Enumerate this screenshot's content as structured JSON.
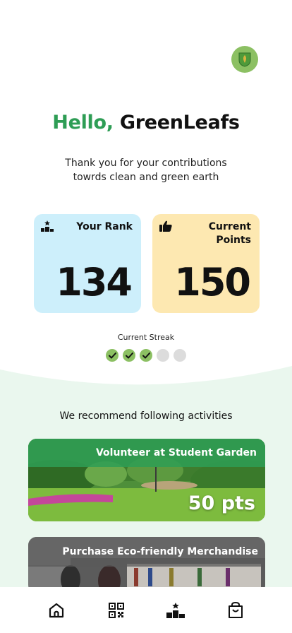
{
  "header": {
    "greeting_hello": "Hello,",
    "greeting_name": "GreenLeafs",
    "subtitle_line1": "Thank you for your contributions",
    "subtitle_line2": "towrds clean and green earth"
  },
  "stats": {
    "rank": {
      "label": "Your Rank",
      "value": "134",
      "icon": "podium-icon",
      "color": "#cdeffb"
    },
    "points": {
      "label_line1": "Current",
      "label_line2": "Points",
      "value": "150",
      "icon": "thumbs-up-icon",
      "color": "#fde8b1"
    }
  },
  "streak": {
    "label": "Current Streak",
    "days": [
      true,
      true,
      true,
      false,
      false
    ]
  },
  "recommendations": {
    "title": "We recommend following activities",
    "items": [
      {
        "title": "Volunteer at Student Garden",
        "points": "50 pts"
      },
      {
        "title": "Purchase Eco-friendly Merchandise"
      }
    ]
  },
  "nav": {
    "items": [
      "home-icon",
      "qr-code-icon",
      "leaderboard-icon",
      "shopping-bag-icon"
    ]
  },
  "colors": {
    "accent_green": "#2e9d55",
    "light_green": "#8cc063",
    "lower_background": "#eaf7ee"
  }
}
